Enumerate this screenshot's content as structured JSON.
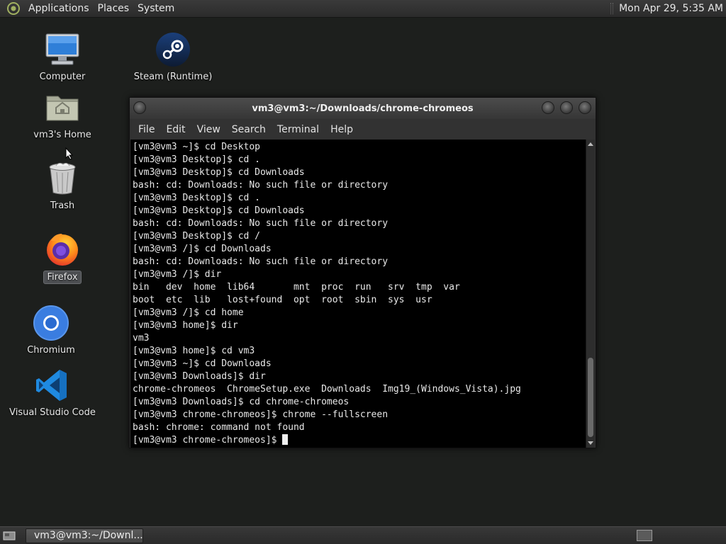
{
  "top_panel": {
    "menus": [
      "Applications",
      "Places",
      "System"
    ],
    "clock": "Mon Apr 29,  5:35 AM"
  },
  "desktop_icons": [
    {
      "label": "Computer",
      "icon": "computer-icon"
    },
    {
      "label": "Steam (Runtime)",
      "icon": "steam-icon"
    },
    {
      "label": "vm3's Home",
      "icon": "home-folder-icon"
    },
    {
      "label": "Trash",
      "icon": "trash-icon"
    },
    {
      "label": "Firefox",
      "icon": "firefox-icon",
      "selected": true
    },
    {
      "label": "Chromium",
      "icon": "chromium-icon"
    },
    {
      "label": "Visual Studio Code",
      "icon": "vscode-icon"
    }
  ],
  "terminal": {
    "title": "vm3@vm3:~/Downloads/chrome-chromeos",
    "menu": [
      "File",
      "Edit",
      "View",
      "Search",
      "Terminal",
      "Help"
    ],
    "lines": [
      "[vm3@vm3 ~]$ cd Desktop",
      "[vm3@vm3 Desktop]$ cd .",
      "[vm3@vm3 Desktop]$ cd Downloads",
      "bash: cd: Downloads: No such file or directory",
      "[vm3@vm3 Desktop]$ cd .",
      "[vm3@vm3 Desktop]$ cd Downloads",
      "bash: cd: Downloads: No such file or directory",
      "[vm3@vm3 Desktop]$ cd /",
      "[vm3@vm3 /]$ cd Downloads",
      "bash: cd: Downloads: No such file or directory",
      "[vm3@vm3 /]$ dir",
      "bin   dev  home  lib64       mnt  proc  run   srv  tmp  var",
      "boot  etc  lib   lost+found  opt  root  sbin  sys  usr",
      "[vm3@vm3 /]$ cd home",
      "[vm3@vm3 home]$ dir",
      "vm3",
      "[vm3@vm3 home]$ cd vm3",
      "[vm3@vm3 ~]$ cd Downloads",
      "[vm3@vm3 Downloads]$ dir",
      "chrome-chromeos  ChromeSetup.exe  Downloads  Img19_(Windows_Vista).jpg",
      "[vm3@vm3 Downloads]$ cd chrome-chromeos",
      "[vm3@vm3 chrome-chromeos]$ chrome --fullscreen",
      "bash: chrome: command not found"
    ],
    "prompt": "[vm3@vm3 chrome-chromeos]$ "
  },
  "taskbar": {
    "window_button": "vm3@vm3:~/Downl..."
  }
}
